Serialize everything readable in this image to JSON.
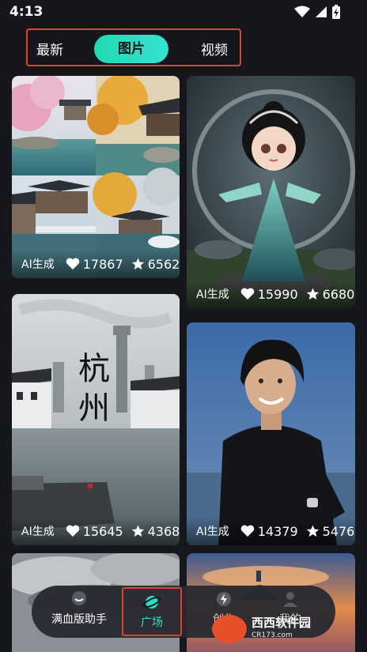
{
  "status_bar": {
    "time": "4:13",
    "icons": [
      "wifi-icon",
      "signal-icon",
      "battery-charging-icon"
    ]
  },
  "tabs": [
    {
      "label": "最新",
      "active": false
    },
    {
      "label": "图片",
      "active": true
    },
    {
      "label": "视频",
      "active": false
    }
  ],
  "accent_color": "#2fdcc0",
  "highlight_color": "#e0432d",
  "cards": [
    {
      "tag": "AI生成",
      "likes": "17867",
      "stars": "6562"
    },
    {
      "tag": "AI生成",
      "likes": "15990",
      "stars": "6680"
    },
    {
      "tag": "AI生成",
      "likes": "15645",
      "stars": "4368"
    },
    {
      "tag": "AI生成",
      "likes": "14379",
      "stars": "5476"
    }
  ],
  "poster_text": {
    "title_1": "杭",
    "title_2": "州"
  },
  "bottom_nav": [
    {
      "label": "满血版助手",
      "icon": "chat-icon",
      "active": false
    },
    {
      "label": "广场",
      "icon": "planet-icon",
      "active": true
    },
    {
      "label": "创作",
      "icon": "bolt-icon",
      "active": false
    },
    {
      "label": "我的",
      "icon": "user-icon",
      "active": false
    }
  ],
  "watermark": {
    "text": "西西软件园",
    "sub": "CR173.com"
  }
}
